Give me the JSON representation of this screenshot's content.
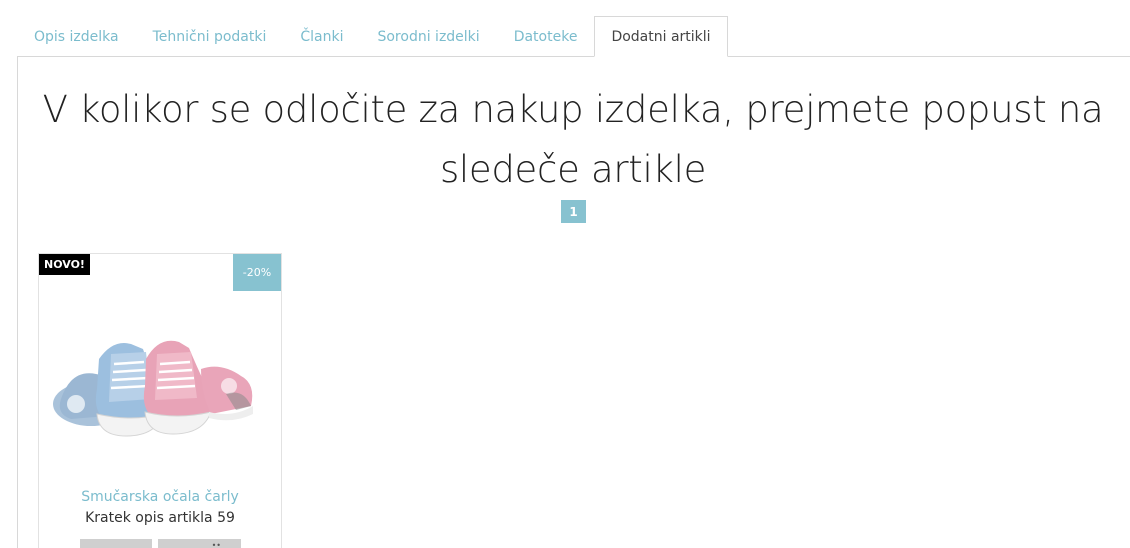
{
  "tabs": [
    {
      "label": "Opis izdelka",
      "active": false
    },
    {
      "label": "Tehnični podatki",
      "active": false
    },
    {
      "label": "Članki",
      "active": false
    },
    {
      "label": "Sorodni izdelki",
      "active": false
    },
    {
      "label": "Datoteke",
      "active": false
    },
    {
      "label": "Dodatni artikli",
      "active": true
    }
  ],
  "main": {
    "headline": "V kolikor se odločite za nakup izdelka, prejmete popust na sledeče artikle",
    "pager": {
      "current_page": "1"
    }
  },
  "product": {
    "badge_new": "NOVO!",
    "badge_discount": "-20%",
    "name": "Smučarska očala čarly",
    "description": "Kratek opis artikla 59",
    "image_icon": "baby-sneakers-image"
  },
  "colors": {
    "accent": "#87c2d0",
    "link": "#7bbccd",
    "badge_new_bg": "#000000"
  }
}
